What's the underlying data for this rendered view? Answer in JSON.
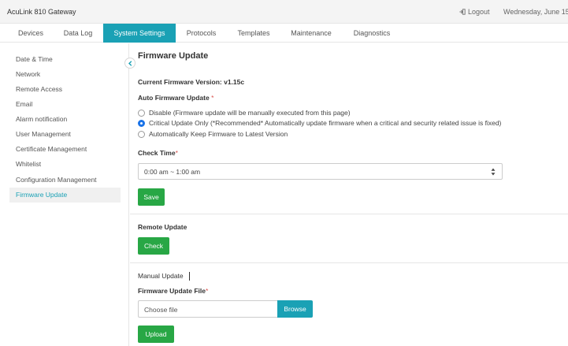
{
  "header": {
    "app_title": "AcuLink 810 Gateway",
    "logout_label": "Logout",
    "date_text": "Wednesday, June 15"
  },
  "nav": {
    "tabs": [
      {
        "label": "Devices",
        "active": false
      },
      {
        "label": "Data Log",
        "active": false
      },
      {
        "label": "System Settings",
        "active": true
      },
      {
        "label": "Protocols",
        "active": false
      },
      {
        "label": "Templates",
        "active": false
      },
      {
        "label": "Maintenance",
        "active": false
      },
      {
        "label": "Diagnostics",
        "active": false
      }
    ]
  },
  "sidebar": {
    "items": [
      {
        "label": "Date & Time",
        "active": false
      },
      {
        "label": "Network",
        "active": false
      },
      {
        "label": "Remote Access",
        "active": false
      },
      {
        "label": "Email",
        "active": false
      },
      {
        "label": "Alarm notification",
        "active": false
      },
      {
        "label": "User Management",
        "active": false
      },
      {
        "label": "Certificate Management",
        "active": false
      },
      {
        "label": "Whitelist",
        "active": false
      },
      {
        "label": "Configuration Management",
        "active": false
      },
      {
        "label": "Firmware Update",
        "active": true
      }
    ]
  },
  "main": {
    "title": "Firmware Update",
    "current_version_label": "Current Firmware Version: v1.15c",
    "auto_update_label": "Auto Firmware Update",
    "required_mark": "*",
    "options": [
      {
        "label": "Disable (Firmware update will be manually executed from this page)",
        "checked": false
      },
      {
        "label": "Critical Update Only (*Recommended* Automatically update firmware when a critical and security related issue is fixed)",
        "checked": true
      },
      {
        "label": "Automatically Keep Firmware to Latest Version",
        "checked": false
      }
    ],
    "check_time_label": "Check Time",
    "check_time_value": "0:00 am ~ 1:00 am",
    "save_label": "Save",
    "remote_update_label": "Remote Update",
    "check_label": "Check",
    "manual_update_label": "Manual Update",
    "firmware_file_label": "Firmware Update File",
    "choose_file_placeholder": "Choose file",
    "browse_label": "Browse",
    "upload_label": "Upload"
  },
  "colors": {
    "accent": "#1aa1b5",
    "success": "#28a745",
    "required": "#d9534f",
    "radio_checked": "#1a73e8"
  }
}
